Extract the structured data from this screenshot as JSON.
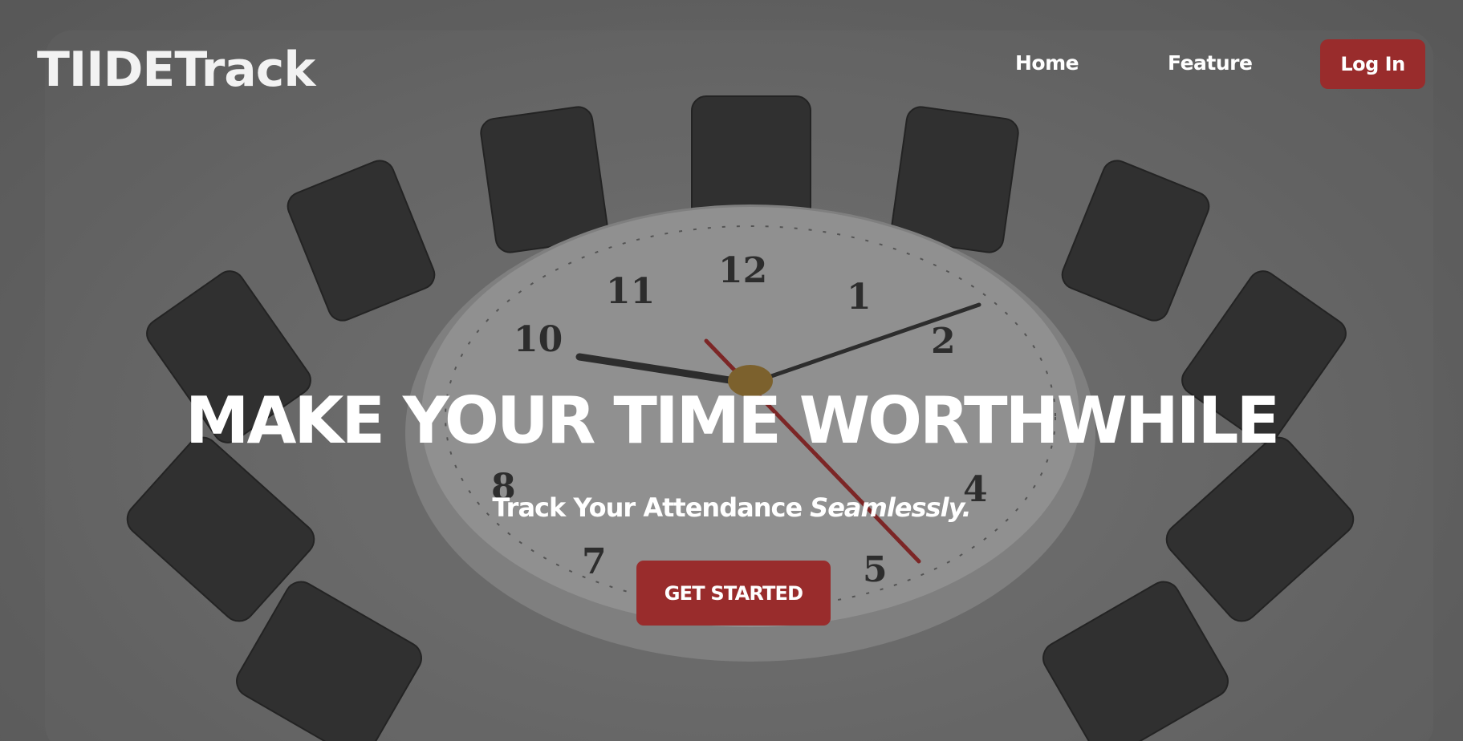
{
  "brand": {
    "name": "TIIDETrack"
  },
  "nav": {
    "home_label": "Home",
    "feature_label": "Feature",
    "login_label": "Log In"
  },
  "hero": {
    "headline": "MAKE YOUR TIME WORTHWHILE",
    "subtitle_main": "Track Your Attendance",
    "subtitle_emphasis": "Seamlessly.",
    "cta_label": "GET STARTED",
    "background_image": "clock-table-with-chairs",
    "clock_numbers": [
      "12",
      "1",
      "2",
      "4",
      "5",
      "7",
      "8",
      "10",
      "11"
    ]
  },
  "colors": {
    "accent": "#992c2c",
    "background": "#6a6a6a",
    "text": "#ffffff"
  }
}
